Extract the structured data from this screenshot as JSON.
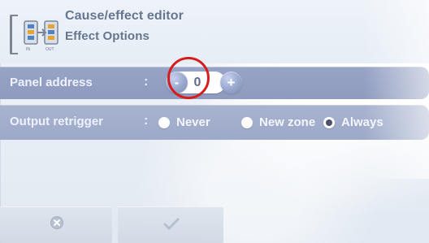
{
  "header": {
    "title": "Cause/effect editor",
    "subtitle": "Effect Options",
    "icon_name": "cause-effect-editor-icon"
  },
  "panel_address": {
    "label": "Panel address",
    "separator": ":",
    "value": "0",
    "decrement_label": "-",
    "increment_label": "+"
  },
  "output_retrigger": {
    "label": "Output retrigger",
    "separator": ":",
    "options": [
      {
        "label": "Never",
        "selected": false
      },
      {
        "label": "New zone",
        "selected": false
      },
      {
        "label": "Always",
        "selected": true
      }
    ]
  },
  "footer": {
    "cancel_icon": "cancel-icon",
    "confirm_icon": "checkmark-icon"
  },
  "colors": {
    "highlight": "#d61c1c",
    "accent": "#8e9bbe",
    "text_primary": "#65758f",
    "text_on_band": "#eef2ff"
  }
}
